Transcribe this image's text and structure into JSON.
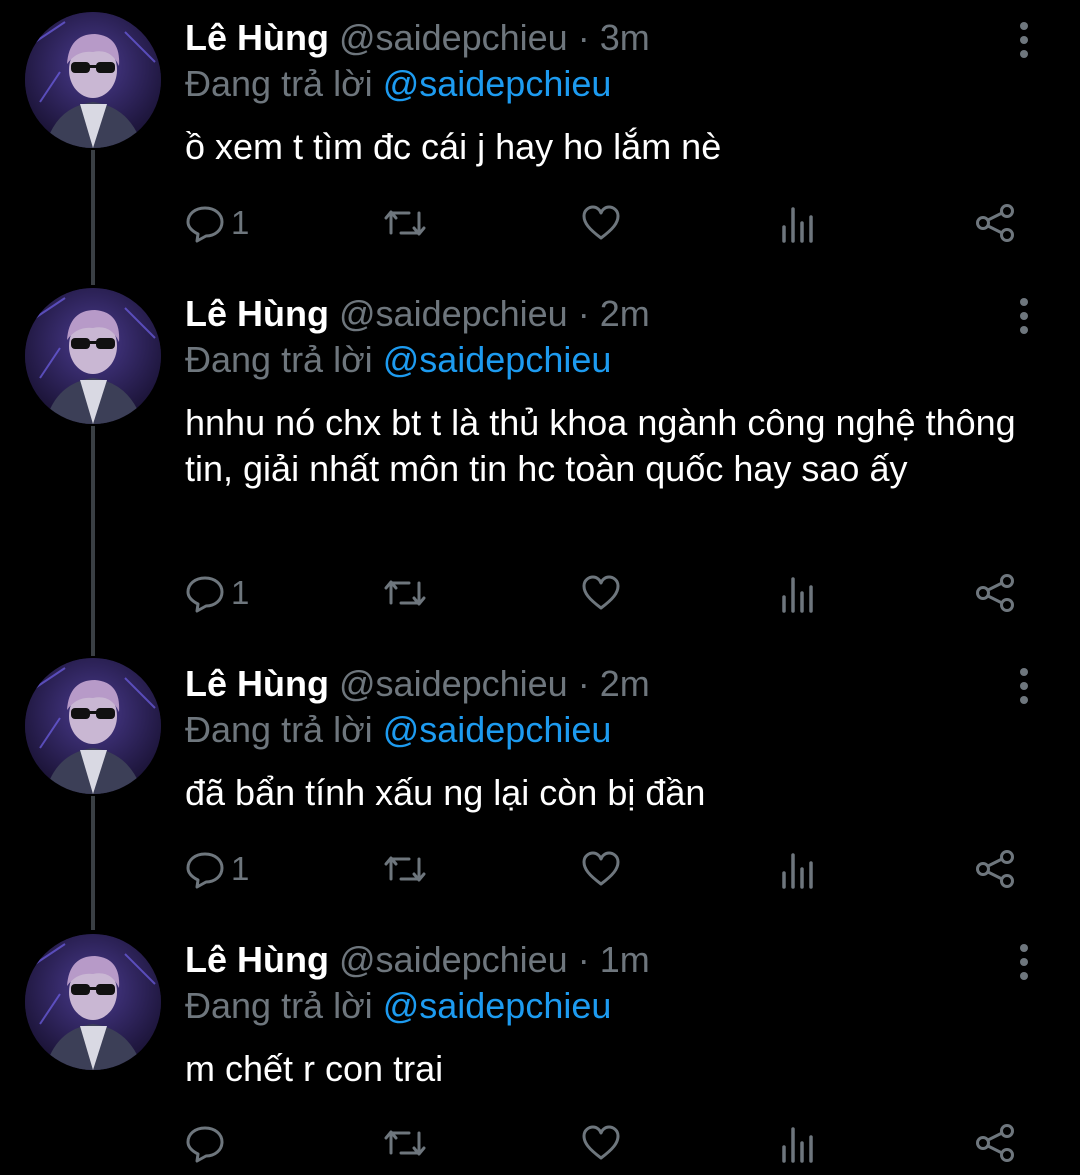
{
  "tweets": [
    {
      "name": "Lê Hùng",
      "handle": "@saidepchieu",
      "time": "3m",
      "replying_label": "Đang trả lời",
      "replying_to": "@saidepchieu",
      "text": "ồ xem t tìm đc cái j hay ho lắm nè",
      "reply_count": "1"
    },
    {
      "name": "Lê Hùng",
      "handle": "@saidepchieu",
      "time": "2m",
      "replying_label": "Đang trả lời",
      "replying_to": "@saidepchieu",
      "text": "hnhu nó chx bt t là thủ khoa ngành công nghệ thông tin, giải nhất môn tin hc toàn quốc hay sao ấy",
      "reply_count": "1"
    },
    {
      "name": "Lê Hùng",
      "handle": "@saidepchieu",
      "time": "2m",
      "replying_label": "Đang trả lời",
      "replying_to": "@saidepchieu",
      "text": "đã bẩn tính xấu ng lại còn bị đần",
      "reply_count": "1"
    },
    {
      "name": "Lê Hùng",
      "handle": "@saidepchieu",
      "time": "1m",
      "replying_label": "Đang trả lời",
      "replying_to": "@saidepchieu",
      "text": "m chết r con trai",
      "reply_count": ""
    }
  ],
  "separator": " · ",
  "icons": {
    "reply": "reply-icon",
    "retweet": "retweet-icon",
    "like": "heart-icon",
    "analytics": "analytics-icon",
    "share": "share-icon",
    "more": "more-vertical-icon"
  },
  "colors": {
    "background": "#000000",
    "primary_text": "#ffffff",
    "secondary_text": "#6e767d",
    "mention": "#1d9bf0",
    "thread_line": "#3a3f44"
  }
}
